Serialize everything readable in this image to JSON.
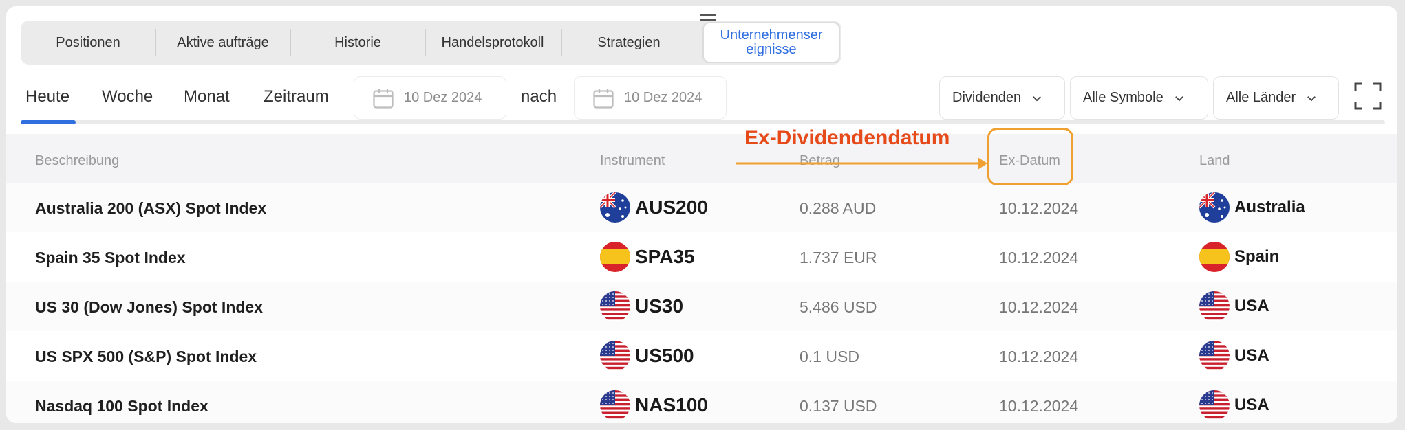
{
  "tabs": [
    {
      "label": "Positionen"
    },
    {
      "label": "Aktive aufträge"
    },
    {
      "label": "Historie"
    },
    {
      "label": "Handelsprotokoll"
    },
    {
      "label": "Strategien"
    },
    {
      "label_line1": "Unternehmenser",
      "label_line2": "eignisse",
      "active": true
    }
  ],
  "periods": [
    "Heute",
    "Woche",
    "Monat",
    "Zeitraum"
  ],
  "date_from": "10 Dez 2024",
  "date_to": "10 Dez 2024",
  "nach": "nach",
  "dropdowns": [
    "Dividenden",
    "Alle Symbole",
    "Alle Länder"
  ],
  "table": {
    "headers": [
      "Beschreibung",
      "Instrument",
      "Betrag",
      "Ex-Datum",
      "Land"
    ],
    "rows": [
      {
        "desc": "Australia 200 (ASX) Spot Index",
        "symbol": "AUS200",
        "flag": "au-flag-icon",
        "betrag": "0.288 AUD",
        "ex": "10.12.2024",
        "land": "Australia"
      },
      {
        "desc": "Spain 35 Spot Index",
        "symbol": "SPA35",
        "flag": "es-flag-icon",
        "betrag": "1.737 EUR",
        "ex": "10.12.2024",
        "land": "Spain"
      },
      {
        "desc": "US 30 (Dow Jones) Spot Index",
        "symbol": "US30",
        "flag": "us-flag-icon",
        "betrag": "5.486 USD",
        "ex": "10.12.2024",
        "land": "USA"
      },
      {
        "desc": "US SPX 500 (S&P) Spot Index",
        "symbol": "US500",
        "flag": "us-flag-icon",
        "betrag": "0.1 USD",
        "ex": "10.12.2024",
        "land": "USA"
      },
      {
        "desc": "Nasdaq 100 Spot Index",
        "symbol": "NAS100",
        "flag": "us-flag-icon",
        "betrag": "0.137 USD",
        "ex": "10.12.2024",
        "land": "USA"
      }
    ]
  },
  "annotation": {
    "label": "Ex-Dividendendatum",
    "color": "#e64a19",
    "box_color": "#f0a030"
  },
  "colors": {
    "accent": "#2f6fe0"
  }
}
